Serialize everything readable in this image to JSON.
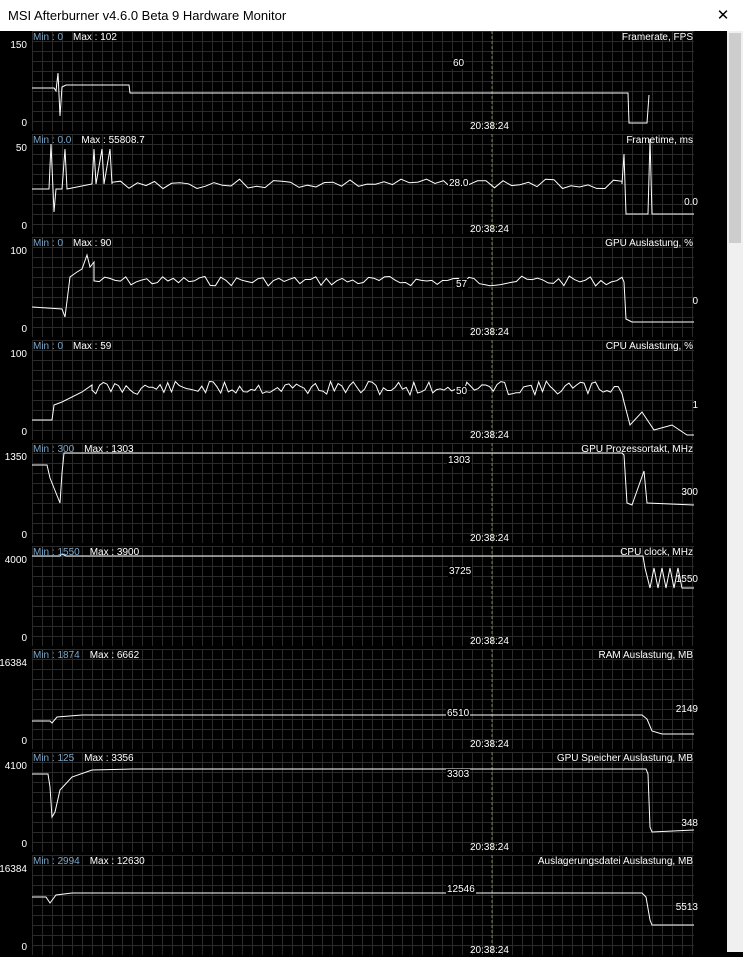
{
  "window": {
    "title": "MSI Afterburner v4.6.0 Beta 9 Hardware Monitor",
    "close_glyph": "✕"
  },
  "timestamp": "20:38:24",
  "graphs": [
    {
      "name": "Framerate, FPS",
      "min_label": "Min : 0",
      "max_label": "Max : 102",
      "y_top": "150",
      "y_bottom": "0",
      "mid_value": "60",
      "current_value": ""
    },
    {
      "name": "Frametime, ms",
      "min_label": "Min : 0.0",
      "max_label": "Max : 55808.7",
      "y_top": "50",
      "y_bottom": "0",
      "mid_value": "28.0",
      "current_value": "0.0"
    },
    {
      "name": "GPU Auslastung, %",
      "min_label": "Min : 0",
      "max_label": "Max : 90",
      "y_top": "100",
      "y_bottom": "0",
      "mid_value": "57",
      "current_value": "0"
    },
    {
      "name": "CPU Auslastung, %",
      "min_label": "Min : 0",
      "max_label": "Max : 59",
      "y_top": "100",
      "y_bottom": "0",
      "mid_value": "50",
      "current_value": "1"
    },
    {
      "name": "GPU Prozessortakt, MHz",
      "min_label": "Min : 300",
      "max_label": "Max : 1303",
      "y_top": "1350",
      "y_bottom": "0",
      "mid_value": "1303",
      "current_value": "300"
    },
    {
      "name": "CPU clock, MHz",
      "min_label": "Min : 1550",
      "max_label": "Max : 3900",
      "y_top": "4000",
      "y_bottom": "0",
      "mid_value": "3725",
      "current_value": "1550"
    },
    {
      "name": "RAM Auslastung, MB",
      "min_label": "Min : 1874",
      "max_label": "Max : 6662",
      "y_top": "16384",
      "y_bottom": "0",
      "mid_value": "6510",
      "current_value": "2149"
    },
    {
      "name": "GPU Speicher Auslastung, MB",
      "min_label": "Min : 125",
      "max_label": "Max : 3356",
      "y_top": "4100",
      "y_bottom": "0",
      "mid_value": "3303",
      "current_value": "348"
    },
    {
      "name": "Auslagerungsdatei Auslastung, MB",
      "min_label": "Min : 2994",
      "max_label": "Max : 12630",
      "y_top": "16384",
      "y_bottom": "0",
      "mid_value": "12546",
      "current_value": "5513"
    }
  ]
}
